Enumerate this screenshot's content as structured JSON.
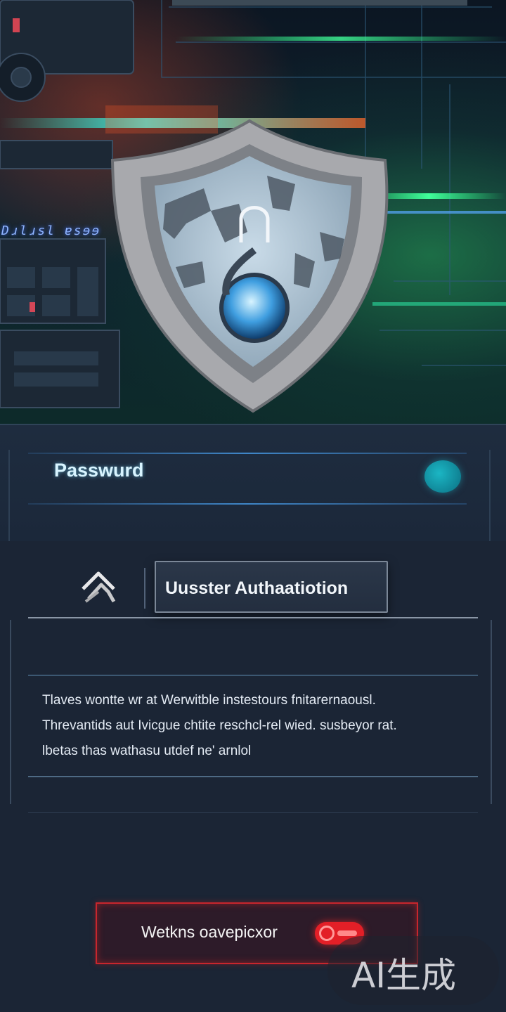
{
  "hero": {
    "caption": "Dɹlɹsl ɐsɘɘ",
    "shield_icon": "shield-lock-icon"
  },
  "password": {
    "label": "Passwurd",
    "toggle_icon": "teal-oval-toggle-icon"
  },
  "auth": {
    "icon": "user-auth-icon",
    "title": "Uusster Authaatiotion"
  },
  "description": {
    "lines": [
      "Tlaves wontte wr at Werwitble instestours fnitarernaousl.",
      "Threvantids aut Ivicgue chtite reschcl-rel wied. susbeyor rat.",
      "lbetas thas wathasu utdef ne' arnlol"
    ]
  },
  "action": {
    "label": "Wetkns oavepicxor",
    "toggle_state": "on",
    "accent": "#e31f27"
  },
  "watermark": {
    "text": "AI生成"
  },
  "colors": {
    "background": "#1b2535",
    "accent_teal": "#1bb6c4",
    "accent_red": "#e31f27"
  }
}
